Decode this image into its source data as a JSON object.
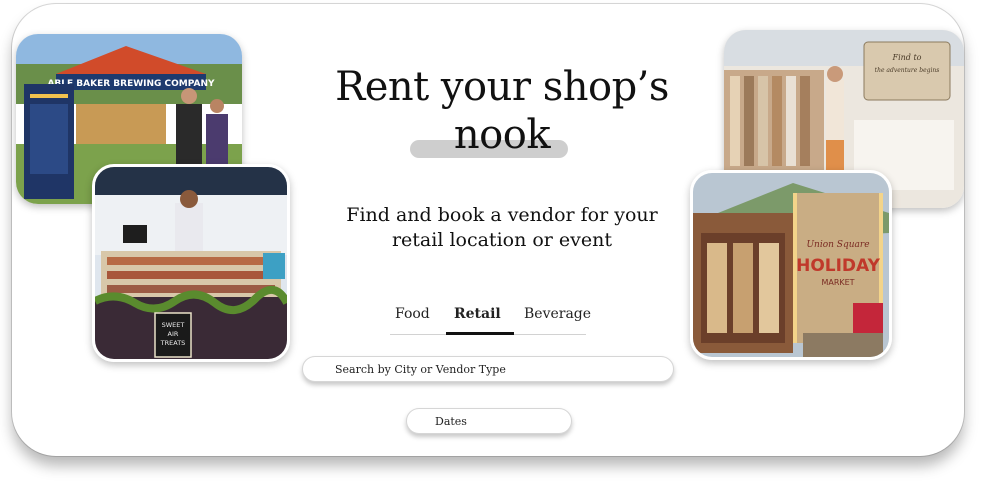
{
  "hero": {
    "headline_line1": "Rent your shop’s",
    "headline_line2": "nook",
    "subhead_line1": "Find and book a vendor for your",
    "subhead_line2": "retail location or event"
  },
  "tabs": [
    {
      "label": "Food",
      "active": false
    },
    {
      "label": "Retail",
      "active": true
    },
    {
      "label": "Beverage",
      "active": false
    }
  ],
  "search": {
    "placeholder": "Search by City or Vendor Type"
  },
  "dates": {
    "label": "Dates"
  },
  "photos": {
    "brewery_sign": "ABLE BAKER BREWING COMPANY",
    "bakery_sign_lines": [
      "SWEET",
      "AIR",
      "TREATS"
    ],
    "boutique_sign_lines": [
      "Find to",
      "the adventure begins"
    ],
    "holiday_sign_lines": [
      "Union Square",
      "HOLIDAY",
      "MARKET"
    ]
  },
  "colors": {
    "text": "#111111",
    "brush": "#c9c9c9",
    "active_tab": "#111111"
  }
}
